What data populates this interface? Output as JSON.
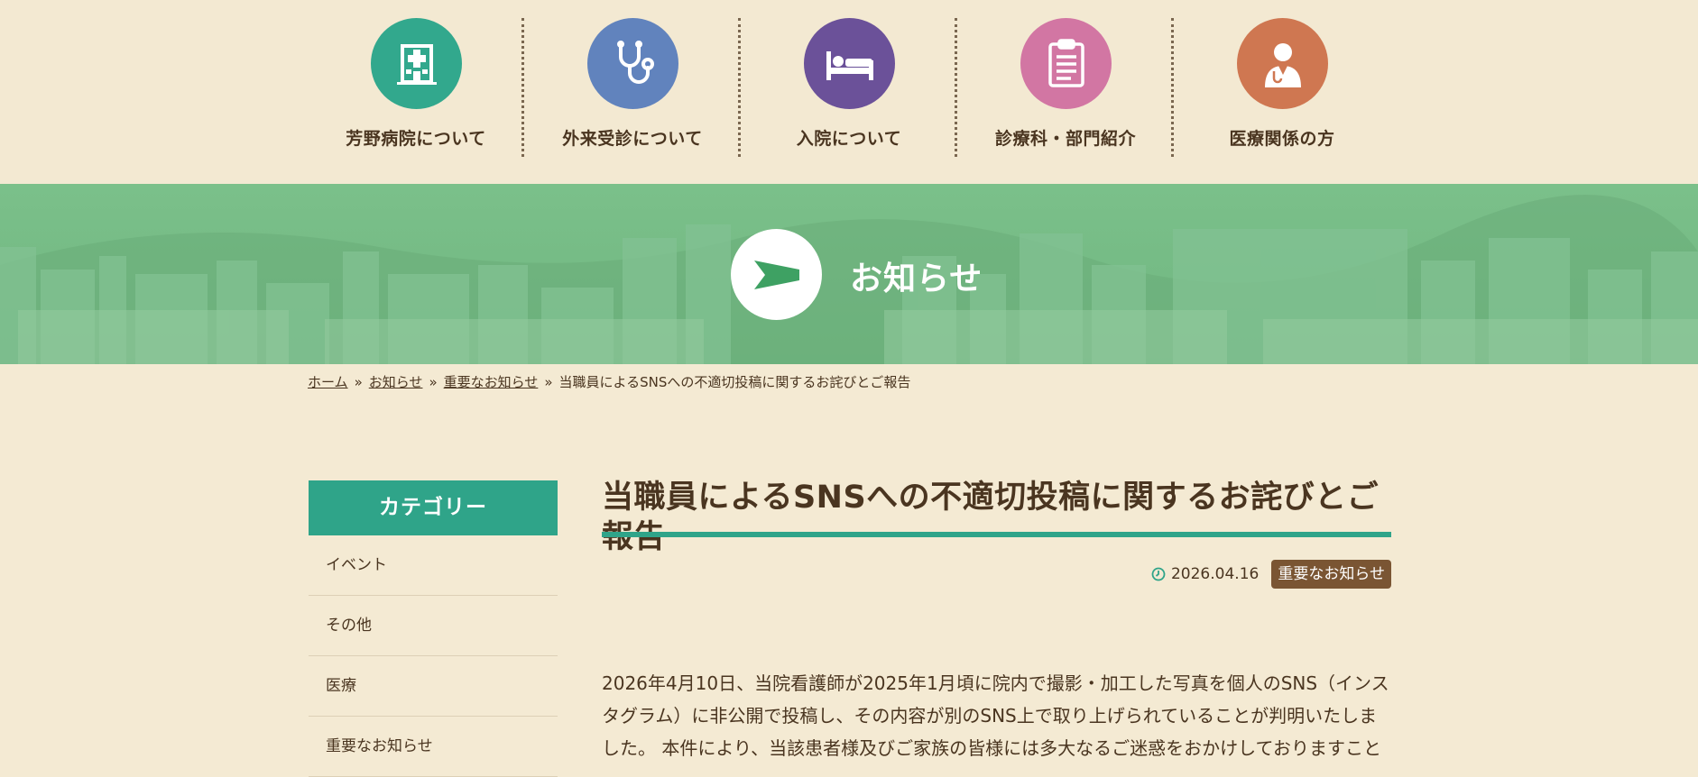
{
  "nav": {
    "items": [
      {
        "label": "芳野病院について",
        "icon": "hospital-building-icon",
        "color": "#32a88d"
      },
      {
        "label": "外来受診について",
        "icon": "stethoscope-icon",
        "color": "#6183bd"
      },
      {
        "label": "入院について",
        "icon": "bed-icon",
        "color": "#6b5199"
      },
      {
        "label": "診療科・部門紹介",
        "icon": "clipboard-icon",
        "color": "#d276a3"
      },
      {
        "label": "医療関係の方",
        "icon": "doctor-icon",
        "color": "#cf7751"
      }
    ]
  },
  "hero": {
    "title": "お知らせ",
    "icon": "megaphone-flag-icon"
  },
  "breadcrumb": {
    "home": "ホーム",
    "news": "お知らせ",
    "category": "重要なお知らせ",
    "current": "当職員によるSNSへの不適切投稿に関するお詫びとご報告",
    "separator": "»"
  },
  "sidebar": {
    "heading": "カテゴリー",
    "items": [
      "イベント",
      "その他",
      "医療",
      "重要なお知らせ"
    ]
  },
  "article": {
    "title": "当職員によるSNSへの不適切投稿に関するお詫びとご報告",
    "date": "2026.04.16",
    "category_badge": "重要なお知らせ",
    "body": "2026年4月10日、当院看護師が2025年1月頃に院内で撮影・加工した写真を個人のSNS（インスタグラム）に非公開で投稿し、その内容が別のSNS上で取り上げられていることが判明いたしました。 本件により、当該患者様及びご家族の皆様には多大なるご迷惑をおかけしておりますこと"
  },
  "colors": {
    "background": "#f4ead3",
    "accent": "#2fa489",
    "badge": "#7a5533",
    "text": "#4a3520"
  }
}
